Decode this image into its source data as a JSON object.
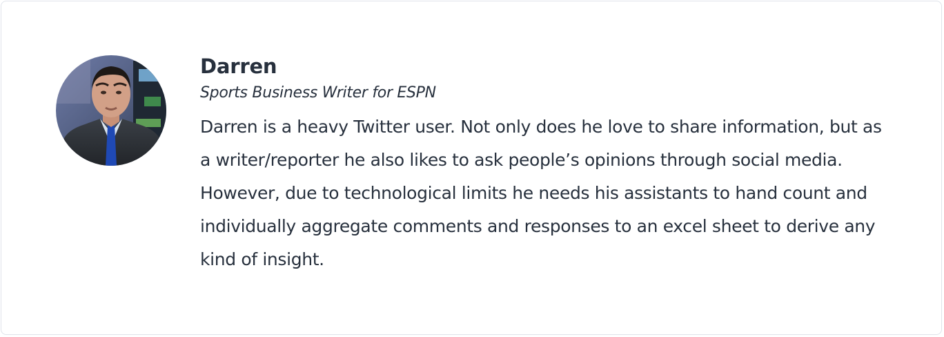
{
  "profile": {
    "name": "Darren",
    "title": "Sports Business Writer for ESPN",
    "bio": "Darren is a heavy Twitter user. Not only does he love to share information, but as a writer/reporter he also likes to ask people’s opinions through social media. However, due to technological limits he needs his assistants to hand count and individually aggregate comments and responses to an excel sheet to derive any kind of insight.",
    "avatar_icon": "person-photo"
  },
  "colors": {
    "text": "#27303d",
    "border": "#dfe3ea",
    "suit": "#2d3136",
    "tie": "#1f49b5",
    "background_studio": "#6f7b9a"
  }
}
